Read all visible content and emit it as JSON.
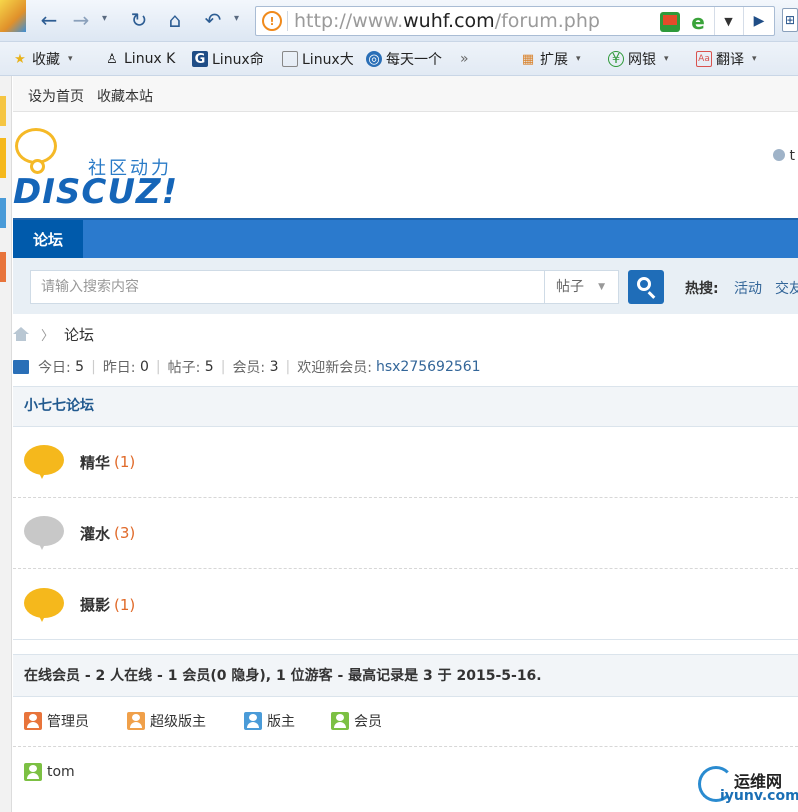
{
  "browser": {
    "url_scheme": "http://www.",
    "url_host": "wuhf.com",
    "url_path": "/forum.php",
    "shield_glyph": "!",
    "bookmarks": [
      {
        "label": "收藏",
        "icon": "star-icon"
      },
      {
        "label": "Linux K",
        "icon": "tux-icon"
      },
      {
        "label": "Linux命",
        "icon": "g-icon"
      },
      {
        "label": "Linux大",
        "icon": "page-icon"
      },
      {
        "label": "每天一个",
        "icon": "globe-icon"
      },
      {
        "label": "扩展",
        "icon": "grid-icon"
      },
      {
        "label": "网银",
        "icon": "yen-icon"
      },
      {
        "label": "翻译",
        "icon": "translate-icon"
      }
    ],
    "more_glyph": "»"
  },
  "topbar": {
    "set_home": "设为首页",
    "add_favorite": "收藏本站"
  },
  "header": {
    "logo_cn": "社区动力",
    "logo_en": "DISCUZ!",
    "user_initial": "t"
  },
  "nav": {
    "forum_tab": "论坛"
  },
  "search": {
    "placeholder": "请输入搜索内容",
    "type": "帖子",
    "hot_label": "热搜:",
    "hot_links": [
      "活动",
      "交友"
    ]
  },
  "breadcrumb": {
    "current": "论坛"
  },
  "stats": {
    "today_label": "今日:",
    "today": "5",
    "yesterday_label": "昨日:",
    "yesterday": "0",
    "posts_label": "帖子:",
    "posts": "5",
    "members_label": "会员:",
    "members": "3",
    "welcome_label": "欢迎新会员:",
    "newest_member": "hsx275692561"
  },
  "category": {
    "title": "小七七论坛",
    "forums": [
      {
        "name": "精华",
        "count": "(1)",
        "color": "#f5b81c"
      },
      {
        "name": "灌水",
        "count": "(3)",
        "color": "#c8c8c8"
      },
      {
        "name": "摄影",
        "count": "(1)",
        "color": "#f5b81c"
      }
    ]
  },
  "online": {
    "title": "在线会员 - 2 人在线 - 1 会员(0 隐身), 1 位游客 - 最高记录是 3 于 2015-5-16.",
    "legend": [
      {
        "label": "管理员",
        "color": "#e8743b"
      },
      {
        "label": "超级版主",
        "color": "#f0a04a"
      },
      {
        "label": "版主",
        "color": "#4a9bd8"
      },
      {
        "label": "会员",
        "color": "#7cc043"
      }
    ],
    "members": [
      {
        "name": "tom",
        "color": "#7cc043"
      }
    ]
  },
  "watermark": {
    "cn": "运维网",
    "en": "iyunv.com"
  }
}
